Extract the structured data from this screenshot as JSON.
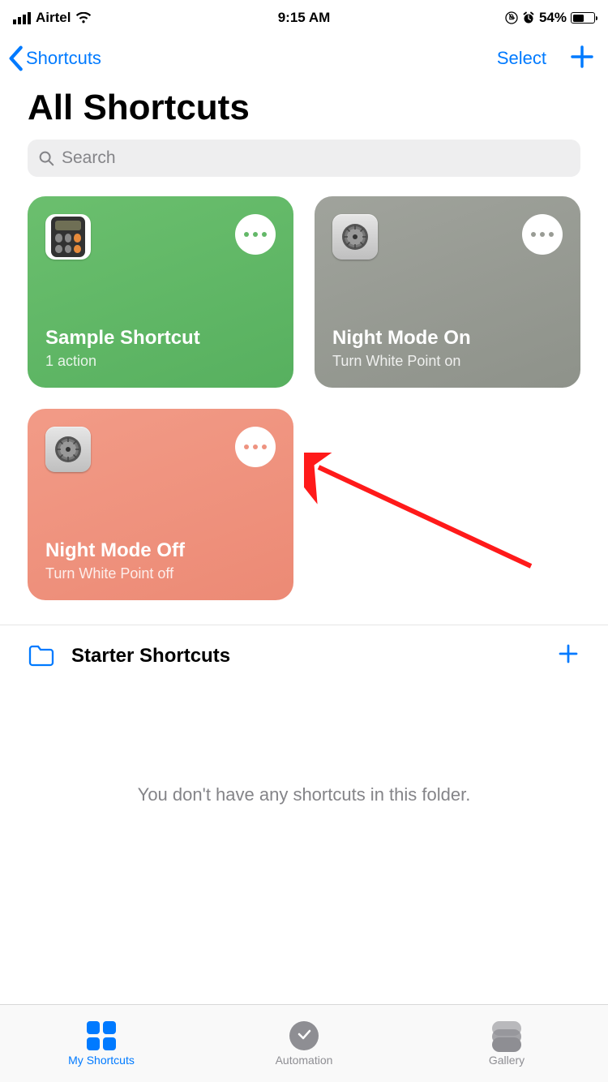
{
  "status": {
    "carrier": "Airtel",
    "time": "9:15 AM",
    "battery_pct": "54%"
  },
  "nav": {
    "back_label": "Shortcuts",
    "select_label": "Select"
  },
  "page_title": "All Shortcuts",
  "search": {
    "placeholder": "Search"
  },
  "shortcuts": [
    {
      "title": "Sample Shortcut",
      "subtitle": "1 action",
      "color": "green",
      "icon": "calculator"
    },
    {
      "title": "Night Mode On",
      "subtitle": "Turn White Point on",
      "color": "grey",
      "icon": "settings"
    },
    {
      "title": "Night Mode Off",
      "subtitle": "Turn White Point off",
      "color": "coral",
      "icon": "settings"
    }
  ],
  "starter": {
    "title": "Starter Shortcuts",
    "empty_text": "You don't have any shortcuts in this folder."
  },
  "tabs": [
    {
      "label": "My Shortcuts",
      "active": true
    },
    {
      "label": "Automation",
      "active": false
    },
    {
      "label": "Gallery",
      "active": false
    }
  ]
}
